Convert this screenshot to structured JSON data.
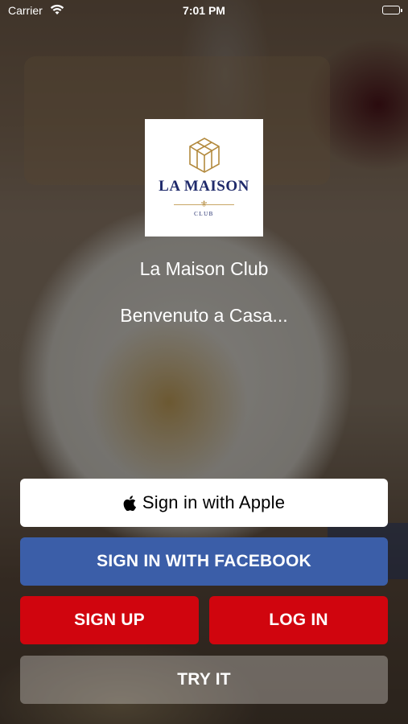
{
  "status_bar": {
    "carrier": "Carrier",
    "time": "7:01 PM"
  },
  "app": {
    "logo": {
      "wordmark": "LA MAISON",
      "subtext": "CLUB"
    },
    "title": "La Maison Club",
    "subtitle": "Benvenuto a Casa..."
  },
  "buttons": {
    "apple": "Sign in with Apple",
    "facebook": "SIGN IN WITH FACEBOOK",
    "signup": "SIGN UP",
    "login": "LOG IN",
    "try": "TRY IT"
  },
  "colors": {
    "facebook": "#3b5ea8",
    "primary_red": "#d0050e",
    "logo_navy": "#1f2a6b",
    "logo_gold": "#b38a3e"
  }
}
